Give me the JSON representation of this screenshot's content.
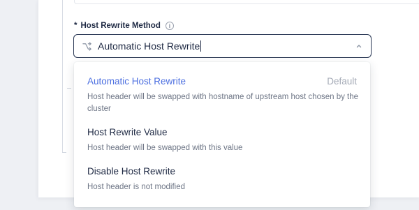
{
  "field": {
    "required_mark": "*",
    "label": "Host Rewrite Method",
    "info_icon": "info-icon",
    "select": {
      "icon": "route-shuffle-icon",
      "value": "Automatic Host Rewrite",
      "chevron_icon": "chevron-up-icon",
      "expanded": true
    }
  },
  "dropdown": {
    "options": [
      {
        "title": "Automatic Host Rewrite",
        "description": "Host header will be swapped with hostname of upstream host chosen by the cluster",
        "tag": "Default",
        "selected": true
      },
      {
        "title": "Host Rewrite Value",
        "description": "Host header will be swapped with this value"
      },
      {
        "title": "Disable Host Rewrite",
        "description": "Host header is not modified"
      }
    ]
  },
  "colors": {
    "accent": "#4c6fe0",
    "text_primary": "#1f2a44",
    "text_secondary": "#6e7686",
    "border_active": "#273552",
    "background": "#eef0f4"
  }
}
